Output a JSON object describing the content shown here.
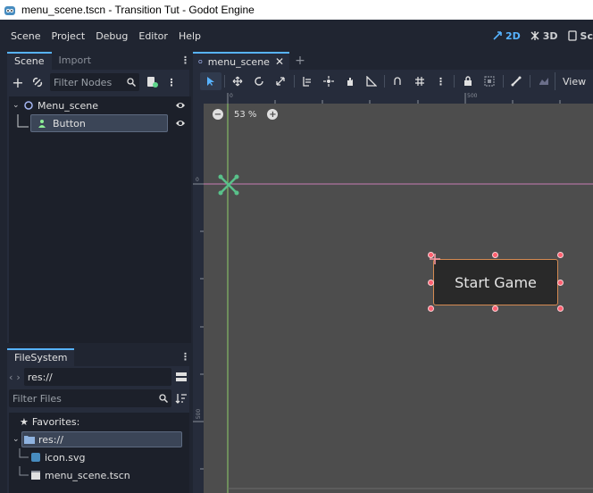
{
  "window": {
    "title": "menu_scene.tscn - Transition Tut - Godot Engine"
  },
  "menu": [
    "Scene",
    "Project",
    "Debug",
    "Editor",
    "Help"
  ],
  "workspaces": [
    {
      "label": "2D",
      "icon": "2d-icon",
      "active": true
    },
    {
      "label": "3D",
      "icon": "3d-icon",
      "active": false
    },
    {
      "label": "Sc",
      "icon": "script-icon",
      "active": false
    }
  ],
  "scene_dock": {
    "tabs": [
      "Scene",
      "Import"
    ],
    "filter_placeholder": "Filter Nodes",
    "nodes": [
      {
        "name": "Menu_scene",
        "icon": "node2d-icon",
        "depth": 0
      },
      {
        "name": "Button",
        "icon": "button-icon",
        "depth": 1,
        "selected": true
      }
    ]
  },
  "filesystem_dock": {
    "tab": "FileSystem",
    "path": "res://",
    "filter_placeholder": "Filter Files",
    "favorites_label": "Favorites:",
    "items": [
      {
        "name": "res://",
        "icon": "folder-icon",
        "depth": 0,
        "selected": true
      },
      {
        "name": "icon.svg",
        "icon": "svg-file-icon",
        "depth": 1
      },
      {
        "name": "menu_scene.tscn",
        "icon": "scene-file-icon",
        "depth": 1
      }
    ]
  },
  "editor": {
    "tab_label": "menu_scene",
    "view_label": "View",
    "zoom": "53 %",
    "ruler_top": [
      "0",
      "500"
    ],
    "ruler_left": [
      "0",
      "500"
    ],
    "button_text": "Start Game"
  },
  "colors": {
    "accent": "#57b3ff",
    "selection_handle": "#ff5f6f",
    "button_border": "#d58a52",
    "viewport_bg": "#4d4d4d"
  }
}
